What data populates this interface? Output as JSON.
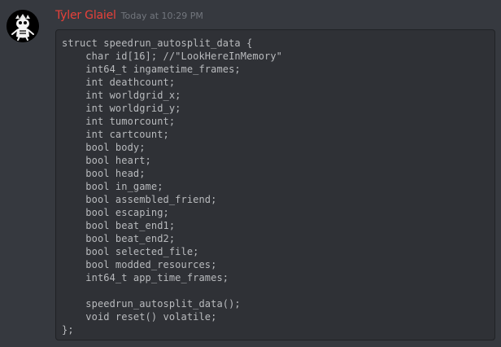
{
  "message": {
    "author": "Tyler Glaiel",
    "timestamp": "Today at 10:29 PM",
    "author_color": "#e8413a",
    "avatar_icon": "skull-creature-icon"
  },
  "code": {
    "lines": [
      "struct speedrun_autosplit_data {",
      "    char id[16]; //\"LookHereInMemory\"",
      "    int64_t ingametime_frames;",
      "    int deathcount;",
      "    int worldgrid_x;",
      "    int worldgrid_y;",
      "    int tumorcount;",
      "    int cartcount;",
      "    bool body;",
      "    bool heart;",
      "    bool head;",
      "    bool in_game;",
      "    bool assembled_friend;",
      "    bool escaping;",
      "    bool beat_end1;",
      "    bool beat_end2;",
      "    bool selected_file;",
      "    bool modded_resources;",
      "    int64_t app_time_frames;",
      "",
      "    speedrun_autosplit_data();",
      "    void reset() volatile;",
      "};"
    ]
  }
}
